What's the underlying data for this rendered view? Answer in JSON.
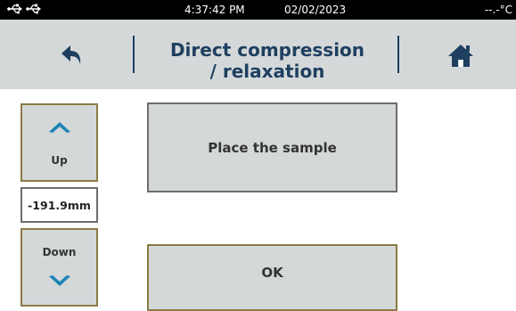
{
  "status": {
    "time": "4:37:42 PM",
    "date": "02/02/2023",
    "temperature": "--.-°C",
    "icons": [
      "usb-icon",
      "usb-icon"
    ]
  },
  "header": {
    "title_line1": "Direct compression",
    "title_line2": "/ relaxation",
    "back_icon": "back-arrow-icon",
    "home_icon": "home-icon"
  },
  "controls": {
    "up_label": "Up",
    "down_label": "Down",
    "position": "-191.9mm"
  },
  "main": {
    "instruction": "Place the sample",
    "ok_label": "OK"
  },
  "colors": {
    "accent": "#1f3f60",
    "chevron": "#1b84b5",
    "panel": "#d4d8d9"
  }
}
